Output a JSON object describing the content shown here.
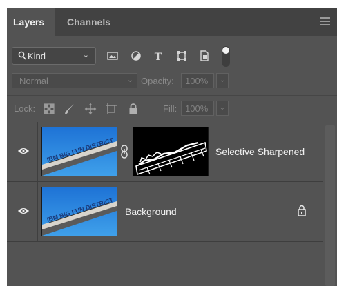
{
  "tabs": [
    {
      "label": "Layers",
      "active": true
    },
    {
      "label": "Channels",
      "active": false
    }
  ],
  "filter": {
    "kind_label": "Kind",
    "icons": [
      "image-filter-icon",
      "adjustment-filter-icon",
      "type-filter-icon",
      "shape-filter-icon",
      "smart-object-filter-icon",
      "filter-toggle-icon"
    ]
  },
  "blend": {
    "mode": "Normal",
    "opacity_label": "Opacity:",
    "opacity_value": "100%"
  },
  "lock": {
    "label": "Lock:",
    "fill_label": "Fill:",
    "fill_value": "100%",
    "icons": [
      "lock-transparent-pixels-icon",
      "lock-image-pixels-icon",
      "lock-position-icon",
      "lock-artboard-icon",
      "lock-all-icon"
    ]
  },
  "layers": [
    {
      "name": "Selective Sharpened",
      "visible": true,
      "has_mask": true,
      "locked": false
    },
    {
      "name": "Background",
      "visible": true,
      "has_mask": false,
      "locked": true
    }
  ],
  "colors": {
    "panel_bg": "#535353",
    "tabbar_bg": "#424242",
    "text": "#f0f0f0",
    "disabled_text": "#8a8a8a",
    "sky_blue": "#2f8fe0"
  }
}
